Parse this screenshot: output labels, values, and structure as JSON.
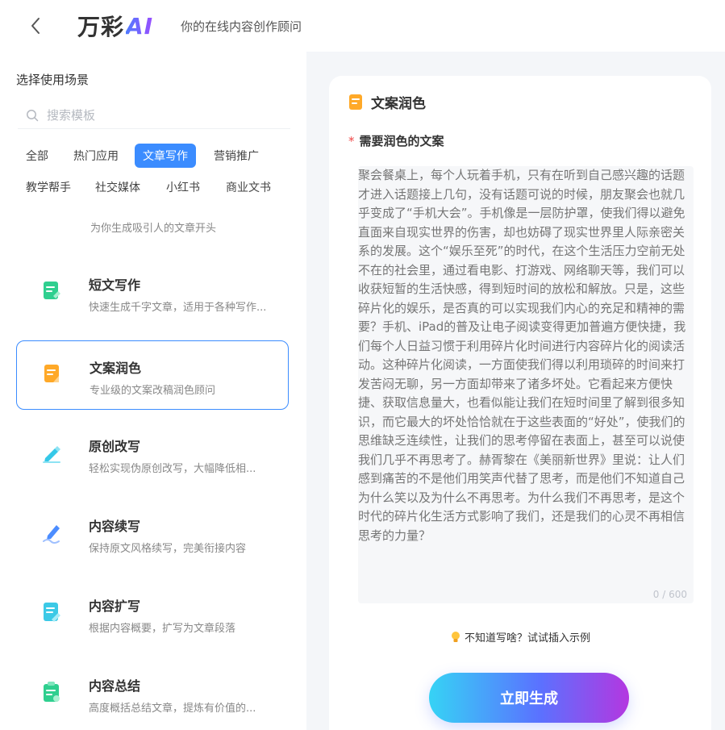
{
  "header": {
    "brand_text": "万彩",
    "brand_ai": "AI",
    "tagline": "你的在线内容创作顾问"
  },
  "sidebar": {
    "title": "选择使用场景",
    "search_placeholder": "搜索模板",
    "categories": [
      "全部",
      "热门应用",
      "文章写作",
      "营销推广",
      "教学帮手",
      "社交媒体",
      "小红书",
      "商业文书"
    ],
    "active_category": "文章写作",
    "hint": "为你生成吸引人的文章开头",
    "templates": [
      {
        "title": "短文写作",
        "desc": "快速生成千字文章，适用于各种写作...",
        "icon": "document-green-icon"
      },
      {
        "title": "文案润色",
        "desc": "专业级的文案改稿润色顾问",
        "icon": "document-orange-icon",
        "selected": true
      },
      {
        "title": "原创改写",
        "desc": "轻松实现伪原创改写，大幅降低相...",
        "icon": "pencil-cyan-icon"
      },
      {
        "title": "内容续写",
        "desc": "保持原文风格续写，完美衔接内容",
        "icon": "pen-blue-icon"
      },
      {
        "title": "内容扩写",
        "desc": "根据内容概要，扩写为文章段落",
        "icon": "notepad-cyan-icon"
      },
      {
        "title": "内容总结",
        "desc": "高度概括总结文章，提炼有价值的...",
        "icon": "clipboard-green-icon"
      }
    ]
  },
  "form": {
    "title": "文案润色",
    "field_label": "需要润色的文案",
    "required_mark": "*",
    "placeholder": "聚会餐桌上，每个人玩着手机，只有在听到自己感兴趣的话题才进入话题接上几句，没有话题可说的时候，朋友聚会也就几乎变成了“手机大会”。手机像是一层防护罩，使我们得以避免直面来自现实世界的伤害，却也妨碍了现实世界里人际亲密关系的发展。这个“娱乐至死”的时代，在这个生活压力空前无处不在的社会里，通过看电影、打游戏、网络聊天等，我们可以收获短暂的生活快感，得到短时间的放松和解放。只是，这些碎片化的娱乐，是否真的可以实现我们内心的充足和精神的需要？手机、iPad的普及让电子阅读变得更加普遍方便快捷，我们每个人日益习惯于利用碎片化时间进行内容碎片化的阅读活动。这种碎片化阅读，一方面使我们得以利用琐碎的时间来打发苦闷无聊，另一方面却带来了诸多坏处。它看起来方便快捷、获取信息量大，也看似能让我们在短时间里了解到很多知识，而它最大的坏处恰恰就在于这些表面的“好处”，使我们的思维缺乏连续性，让我们的思考停留在表面上，甚至可以说使我们几乎不再思考了。赫胥黎在《美丽新世界》里说：让人们感到痛苦的不是他们用笑声代替了思考，而是他们不知道自己为什么笑以及为什么不再思考。为什么我们不再思考，是这个时代的碎片化生活方式影响了我们，还是我们的心灵不再相信思考的力量？",
    "counter": "0 / 600",
    "example_text": "不知道写啥？试试插入示例",
    "generate_label": "立即生成"
  },
  "colors": {
    "accent": "#3b8cff",
    "required": "#f04848",
    "button_gradient_start": "#36d3f5",
    "button_gradient_end": "#b437e0"
  }
}
